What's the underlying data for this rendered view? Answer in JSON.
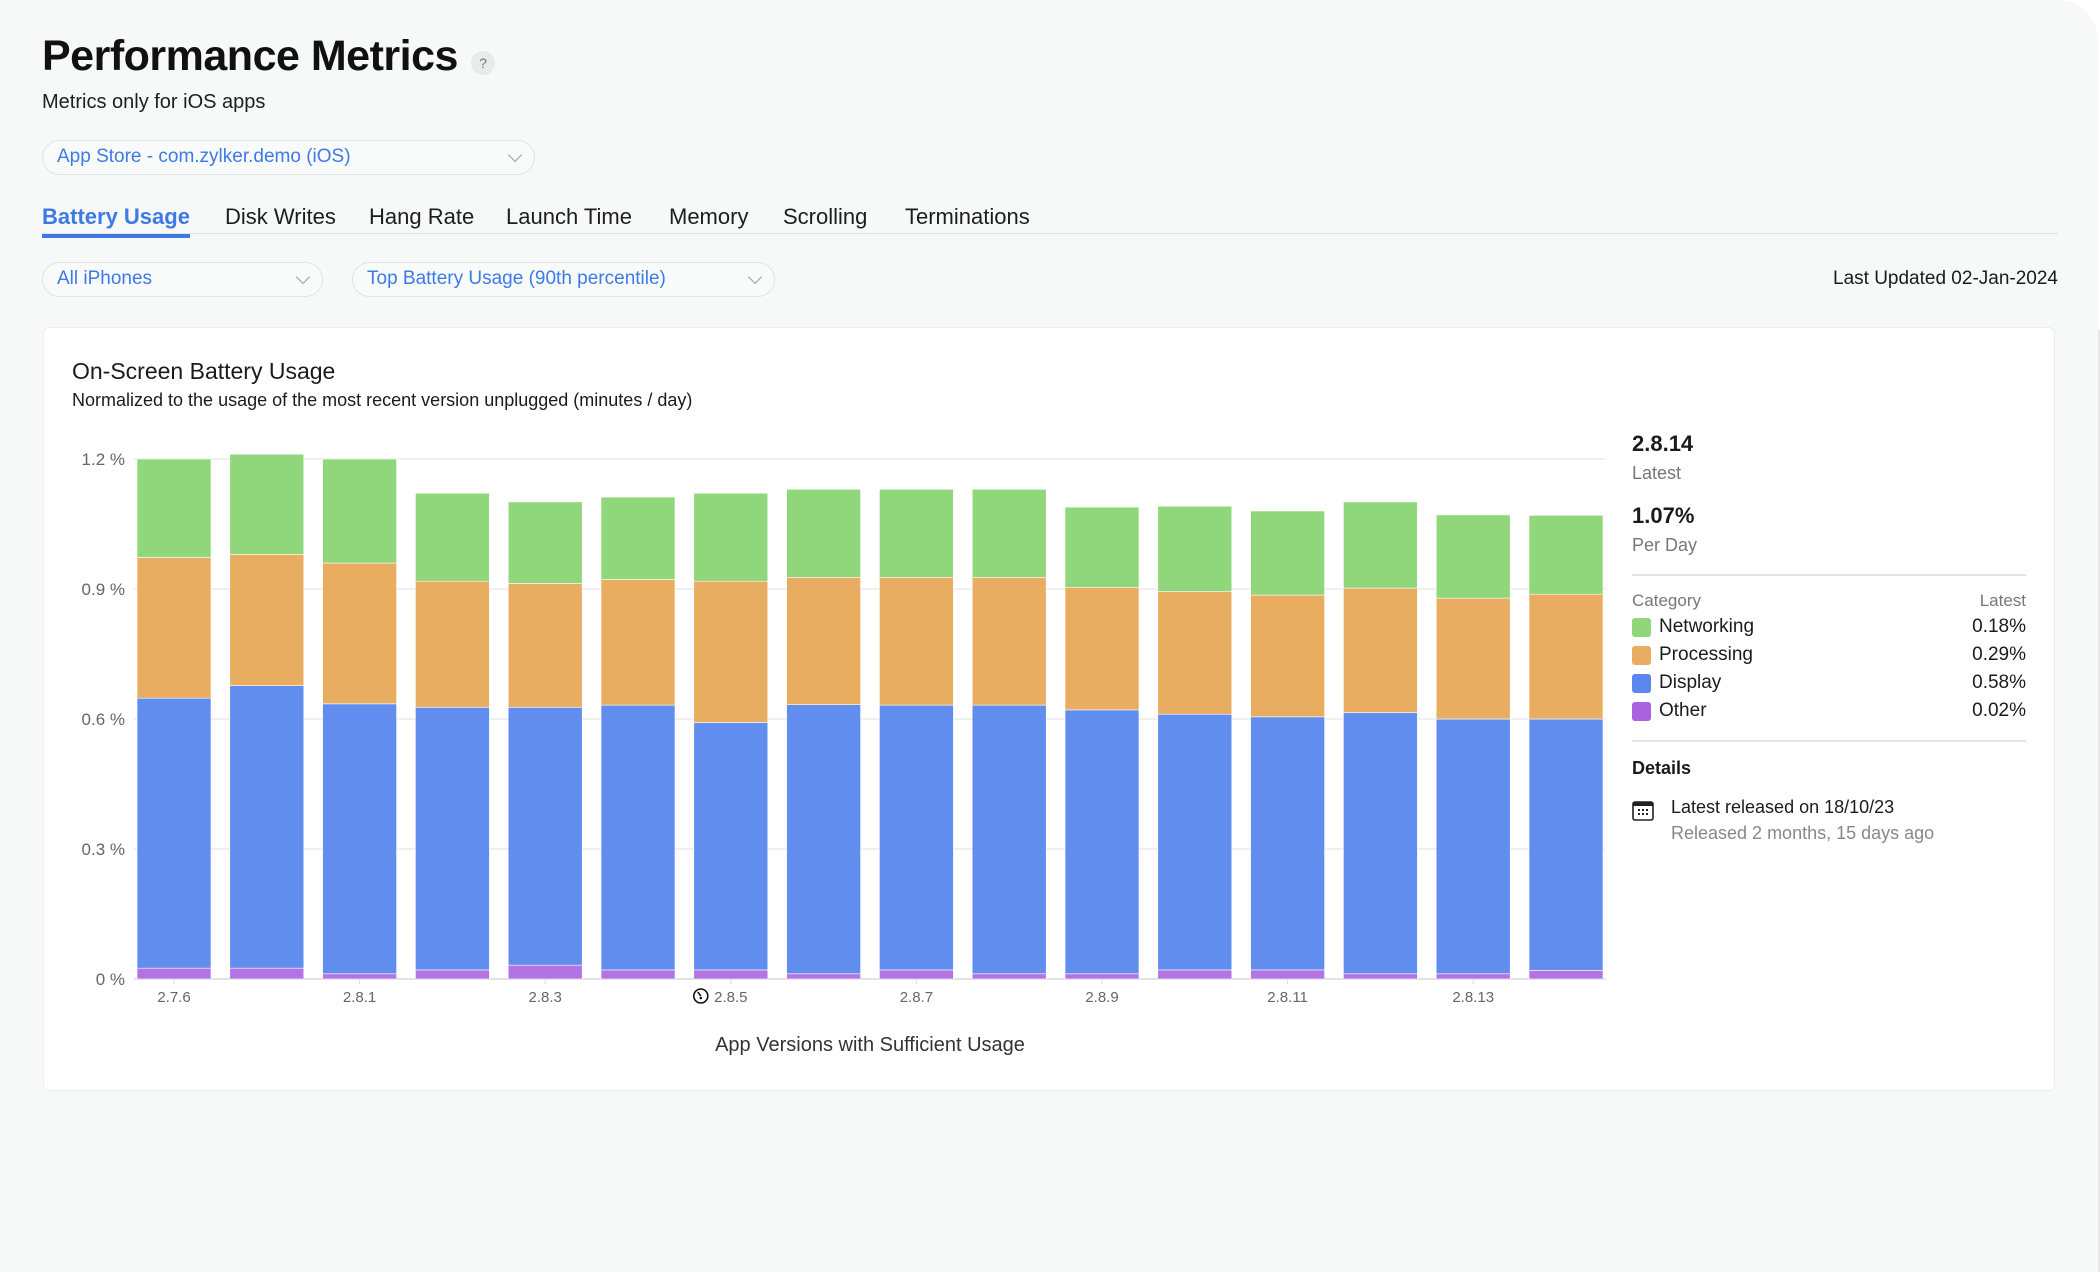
{
  "header": {
    "title": "Performance Metrics",
    "help_icon": "?",
    "subtitle": "Metrics only for iOS apps"
  },
  "store_select": {
    "value": "App Store - com.zylker.demo (iOS)"
  },
  "tabs": [
    {
      "label": "Battery Usage",
      "active": true
    },
    {
      "label": "Disk Writes",
      "active": false
    },
    {
      "label": "Hang Rate",
      "active": false
    },
    {
      "label": "Launch Time",
      "active": false
    },
    {
      "label": "Memory",
      "active": false
    },
    {
      "label": "Scrolling",
      "active": false
    },
    {
      "label": "Terminations",
      "active": false
    }
  ],
  "filters": {
    "device": "All iPhones",
    "metric": "Top Battery Usage (90th percentile)"
  },
  "last_updated": "Last Updated 02-Jan-2024",
  "colors": {
    "accent": "#3d7ae6",
    "networking": "#90d67b",
    "processing": "#e8ad60",
    "display": "#618def",
    "other": "#b274e3"
  },
  "chart_data": {
    "type": "bar",
    "stacked": true,
    "title": "On-Screen Battery Usage",
    "subtitle": "Normalized to the usage of the most recent version unplugged (minutes / day)",
    "xlabel": "App Versions with Sufficient Usage",
    "ylabel": "",
    "ylim": [
      0,
      1.2
    ],
    "yticks": [
      0,
      0.3,
      0.6,
      0.9,
      1.2
    ],
    "ytick_labels": [
      "0 %",
      "0.3 %",
      "0.6 %",
      "0.9 %",
      "1.2 %"
    ],
    "grid": true,
    "legend": "right-panel",
    "categories": [
      "2.7.6",
      "",
      "2.8.1",
      "",
      "2.8.3",
      "",
      "2.8.5",
      "",
      "2.8.7",
      "",
      "2.8.9",
      "",
      "2.8.11",
      "",
      "2.8.13",
      ""
    ],
    "marked_category_index": 6,
    "marked_category_icon": "gauge-icon",
    "series": [
      {
        "name": "Other",
        "color": "#b274e3",
        "values": [
          0.025,
          0.025,
          0.012,
          0.021,
          0.032,
          0.021,
          0.021,
          0.012,
          0.021,
          0.012,
          0.012,
          0.021,
          0.021,
          0.012,
          0.012,
          0.02
        ]
      },
      {
        "name": "Display",
        "color": "#618def",
        "values": [
          0.623,
          0.652,
          0.623,
          0.606,
          0.595,
          0.611,
          0.571,
          0.621,
          0.611,
          0.62,
          0.609,
          0.59,
          0.584,
          0.603,
          0.588,
          0.58
        ]
      },
      {
        "name": "Processing",
        "color": "#e8ad60",
        "values": [
          0.325,
          0.303,
          0.325,
          0.291,
          0.286,
          0.29,
          0.326,
          0.294,
          0.295,
          0.295,
          0.283,
          0.283,
          0.281,
          0.287,
          0.279,
          0.288
        ]
      },
      {
        "name": "Networking",
        "color": "#90d67b",
        "values": [
          0.227,
          0.231,
          0.24,
          0.203,
          0.188,
          0.19,
          0.203,
          0.203,
          0.203,
          0.203,
          0.185,
          0.197,
          0.194,
          0.199,
          0.192,
          0.182
        ]
      }
    ]
  },
  "summary": {
    "version": "2.8.14",
    "version_label": "Latest",
    "per_day": "1.07%",
    "per_day_label": "Per Day",
    "legend_header_left": "Category",
    "legend_header_right": "Latest",
    "legend": [
      {
        "name": "Networking",
        "value": "0.18%",
        "color": "#90d67b"
      },
      {
        "name": "Processing",
        "value": "0.29%",
        "color": "#e8ad60"
      },
      {
        "name": "Display",
        "value": "0.58%",
        "color": "#5a87ee"
      },
      {
        "name": "Other",
        "value": "0.02%",
        "color": "#a962e0"
      }
    ],
    "details_title": "Details",
    "release_line": "Latest released on 18/10/23",
    "release_sub": "Released 2 months, 15 days ago"
  }
}
